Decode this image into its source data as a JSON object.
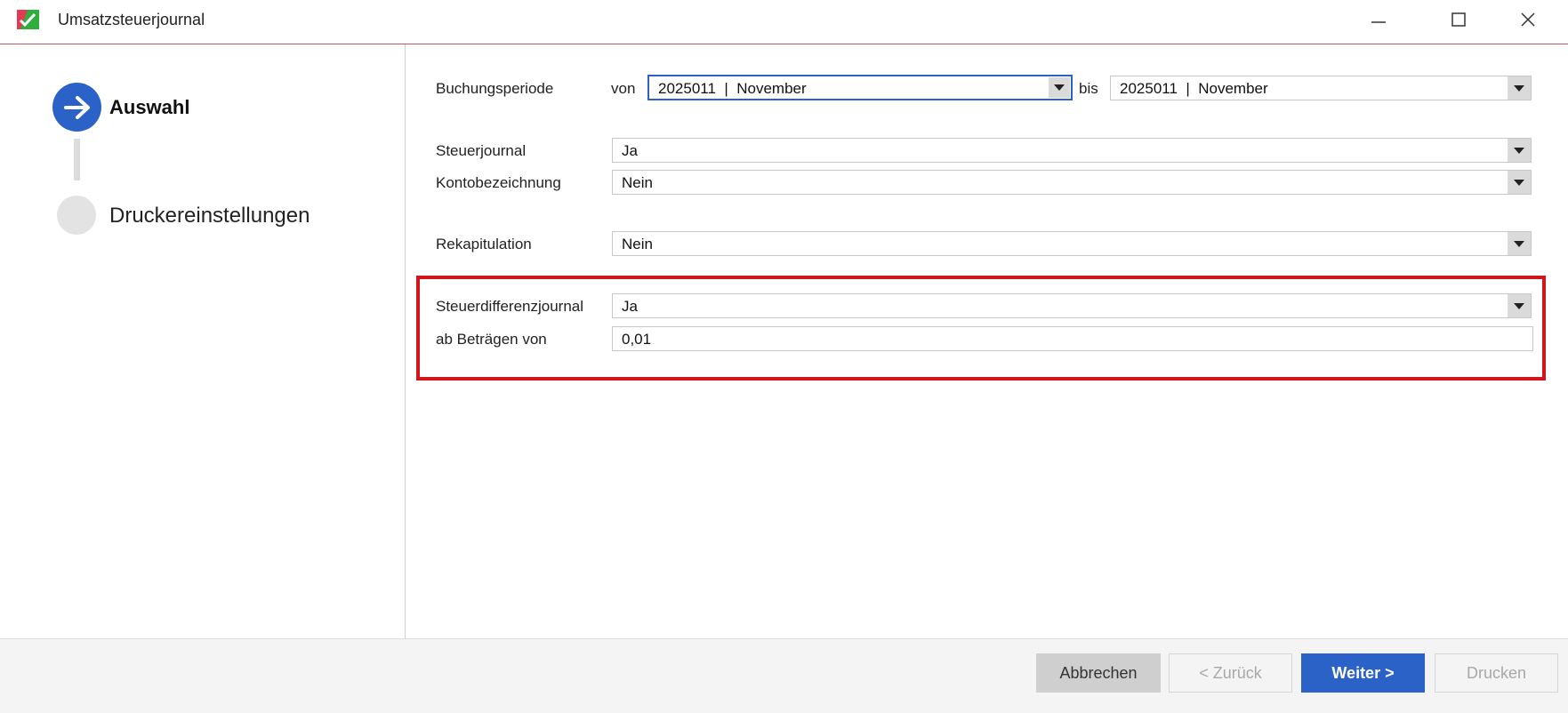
{
  "window": {
    "title": "Umsatzsteuerjournal",
    "icons": [
      "app-icon",
      "minimize-icon",
      "maximize-icon",
      "close-icon"
    ]
  },
  "steps": {
    "active_label": "Auswahl",
    "next_label": "Druckereinstellungen"
  },
  "form": {
    "buchungsperiode_label": "Buchungsperiode",
    "von_label": "von",
    "von_value": "2025011  |  November",
    "bis_label": "bis",
    "bis_value": "2025011  |  November",
    "steuerjournal_label": "Steuerjournal",
    "steuerjournal_value": "Ja",
    "kontobezeichnung_label": "Kontobezeichnung",
    "kontobezeichnung_value": "Nein",
    "rekapitulation_label": "Rekapitulation",
    "rekapitulation_value": "Nein",
    "steuerdifferenz_label": "Steuerdifferenzjournal",
    "steuerdifferenz_value": "Ja",
    "betraege_label": "ab Beträgen von",
    "betraege_value": "0,01"
  },
  "buttons": {
    "abbrechen": "Abbrechen",
    "zurueck": "< Zurück",
    "weiter": "Weiter >",
    "drucken": "Drucken"
  },
  "colors": {
    "accent": "#2b62c7",
    "highlight": "#d0161b",
    "title_rule": "#b35a6b"
  }
}
